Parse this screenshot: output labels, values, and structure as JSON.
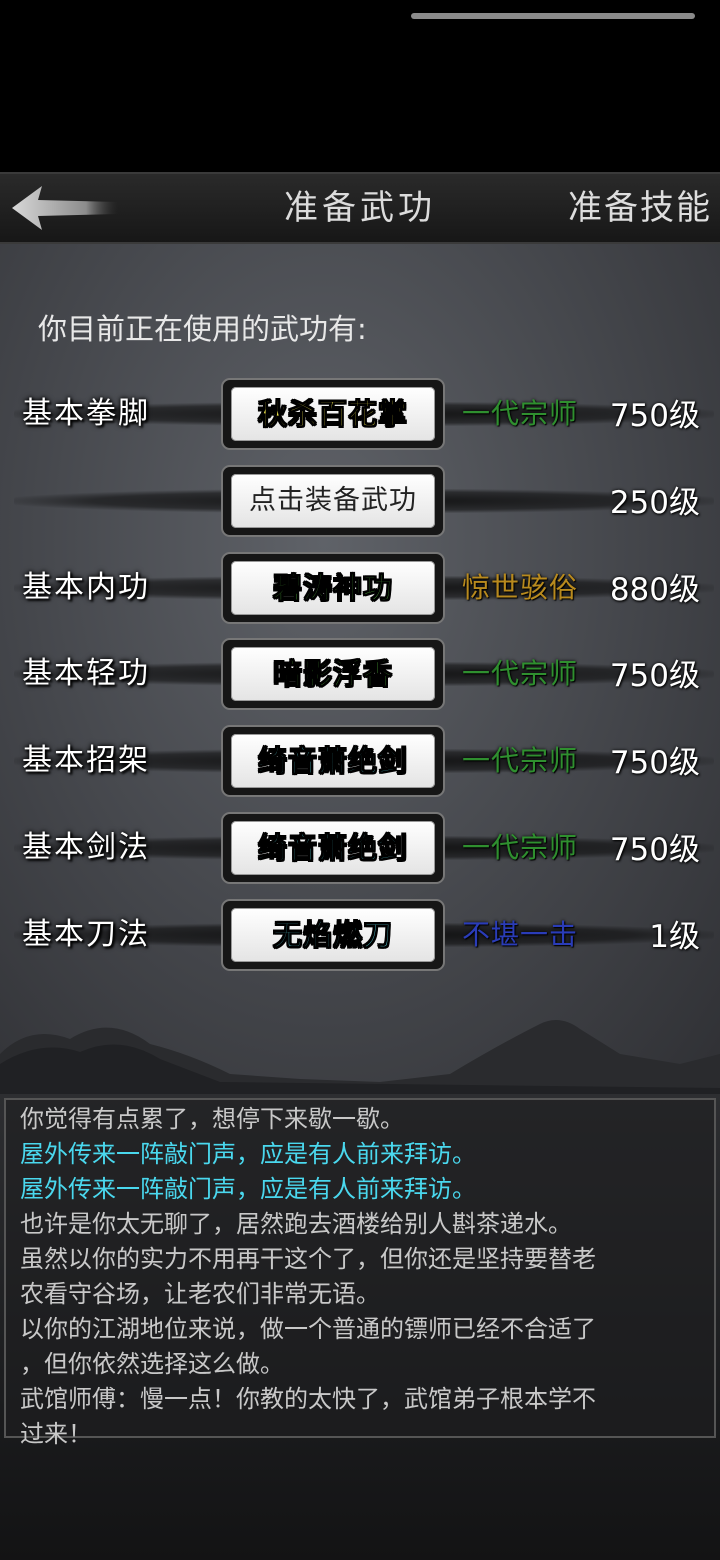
{
  "header": {
    "title": "准备武功",
    "tab_skills": "准备技能"
  },
  "section_label": "你目前正在使用的武功有:",
  "rows": [
    {
      "category": "基本拳脚",
      "skill": "秋杀百花掌",
      "skill_color": "#f2e64a",
      "rank": "一代宗师",
      "rank_color": "#2f8f2f",
      "level": "750级"
    },
    {
      "category": "",
      "skill": "点击装备武功",
      "skill_color": "#222222",
      "rank": "",
      "rank_color": "#2f8f2f",
      "level": "250级"
    },
    {
      "category": "基本内功",
      "skill": "碧涛神功",
      "skill_color": "#5fd045",
      "rank": "惊世骇俗",
      "rank_color": "#b88a1e",
      "level": "880级"
    },
    {
      "category": "基本轻功",
      "skill": "暗影浮香",
      "skill_color": "#5fd045",
      "rank": "一代宗师",
      "rank_color": "#2f8f2f",
      "level": "750级"
    },
    {
      "category": "基本招架",
      "skill": "绮音萧绝剑",
      "skill_color": "#5ad6e0",
      "rank": "一代宗师",
      "rank_color": "#2f8f2f",
      "level": "750级"
    },
    {
      "category": "基本剑法",
      "skill": "绮音萧绝剑",
      "skill_color": "#5ad6e0",
      "rank": "一代宗师",
      "rank_color": "#2f8f2f",
      "level": "750级"
    },
    {
      "category": "基本刀法",
      "skill": "无焰燃刀",
      "skill_color": "#5ad6e0",
      "rank": "不堪一击",
      "rank_color": "#2a3cb8",
      "level": "1级"
    }
  ],
  "log": [
    {
      "text": "你觉得有点累了，想停下来歇一歇。",
      "color": "#c8c8c8"
    },
    {
      "text": "屋外传来一阵敲门声，应是有人前来拜访。",
      "color": "#4ad8ee"
    },
    {
      "text": "屋外传来一阵敲门声，应是有人前来拜访。",
      "color": "#4ad8ee"
    },
    {
      "text": "也许是你太无聊了，居然跑去酒楼给别人斟茶递水。",
      "color": "#c8c8c8"
    },
    {
      "text": "虽然以你的实力不用再干这个了，但你还是坚持要替老",
      "color": "#c8c8c8"
    },
    {
      "text": "农看守谷场，让老农们非常无语。",
      "color": "#c8c8c8"
    },
    {
      "text": "以你的江湖地位来说，做一个普通的镖师已经不合适了",
      "color": "#c8c8c8"
    },
    {
      "text": "，但你依然选择这么做。",
      "color": "#c8c8c8"
    },
    {
      "text": "武馆师傅：慢一点！你教的太快了，武馆弟子根本学不",
      "color": "#c8c8c8"
    },
    {
      "text": "过来！",
      "color": "#c8c8c8"
    }
  ]
}
